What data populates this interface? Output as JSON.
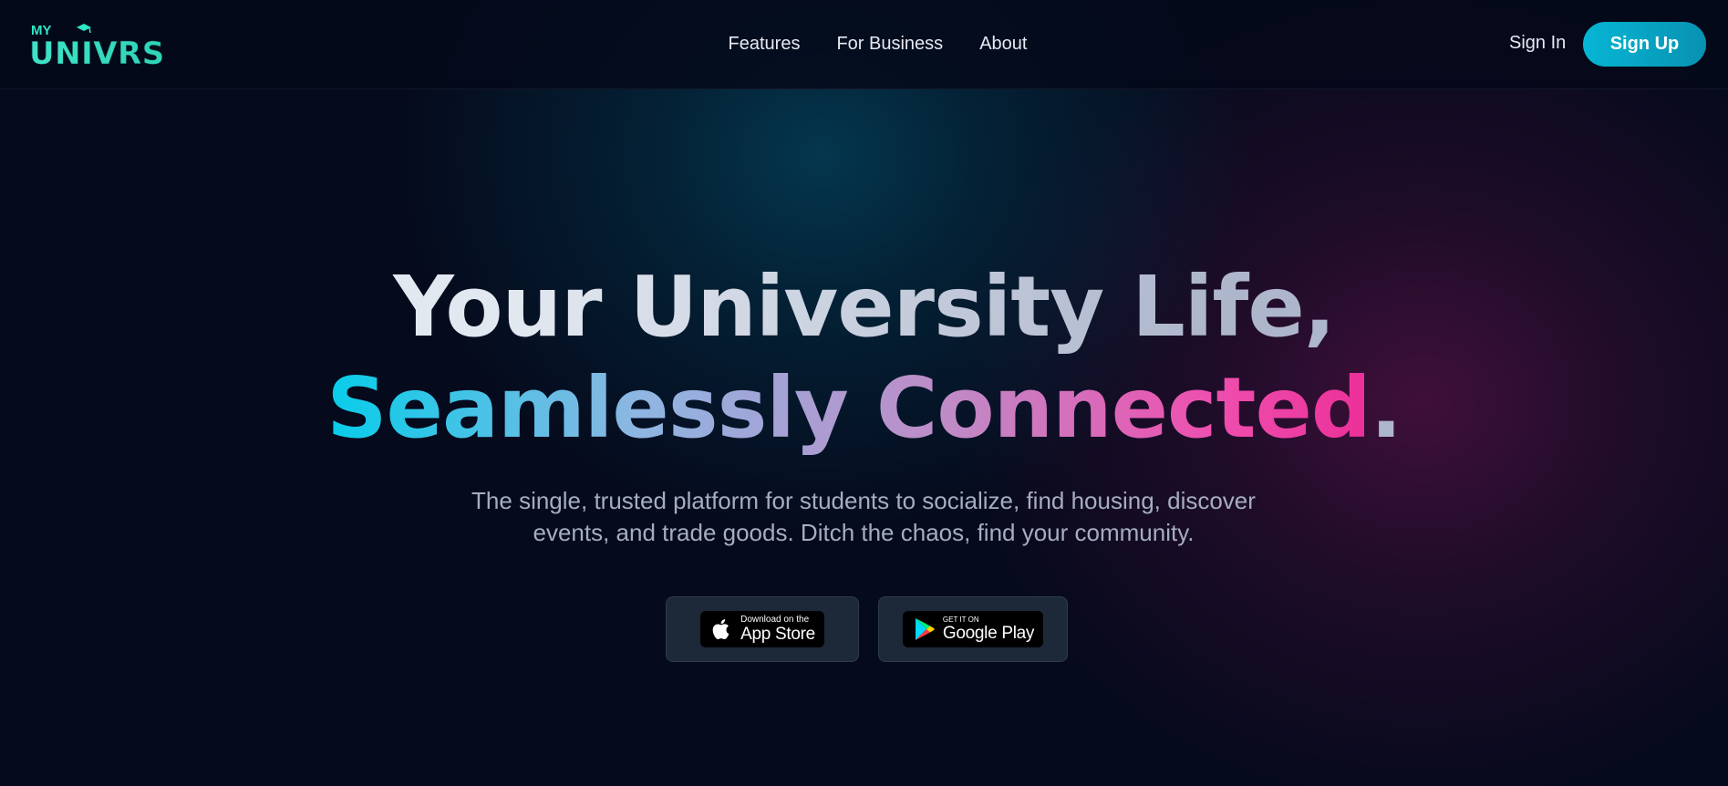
{
  "header": {
    "logo": {
      "top_text": "MY",
      "main_text": "UNIVRS"
    },
    "nav": [
      {
        "label": "Features"
      },
      {
        "label": "For Business"
      },
      {
        "label": "About"
      }
    ],
    "sign_in_label": "Sign In",
    "sign_up_label": "Sign Up"
  },
  "hero": {
    "title_line1": "Your University Life,",
    "title_line2_highlight": "Seamlessly Connected",
    "title_line2_dot": ".",
    "subtitle_line1": "The single, trusted platform for students to socialize, find housing, discover",
    "subtitle_line2": "events, and trade goods. Ditch the chaos, find your community."
  },
  "downloads": {
    "app_store": {
      "small": "Download on the",
      "big": "App Store"
    },
    "google_play": {
      "small": "GET IT ON",
      "big": "Google Play"
    }
  },
  "colors": {
    "background": "#050a1c",
    "accent_cyan": "#06b6d4",
    "accent_pink": "#ec2f98",
    "logo_teal": "#2ee6c6"
  }
}
